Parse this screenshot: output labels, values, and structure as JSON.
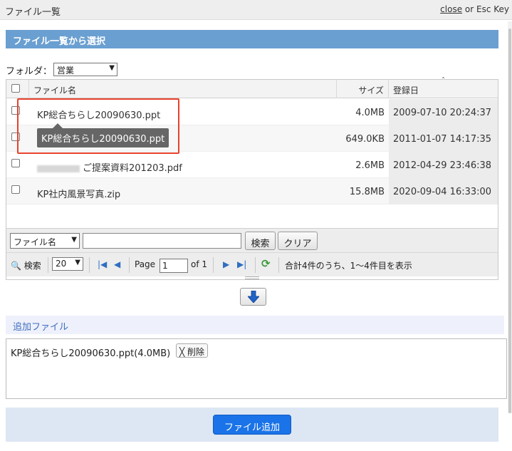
{
  "window": {
    "title": "ファイル一覧",
    "close_link": "close",
    "close_suffix": " or Esc Key"
  },
  "panel": {
    "header": "ファイル一覧から選択",
    "folder_label": "フォルダ：",
    "folder_value": "営業"
  },
  "grid": {
    "columns": {
      "name": "ファイル名",
      "size": "サイズ",
      "date": "登録日"
    },
    "rows": [
      {
        "name": "KP総合ちらし20090630.ppt",
        "size": "4.0MB",
        "date": "2009-07-10 20:24:37"
      },
      {
        "name": "",
        "size": "649.0KB",
        "date": "2011-01-07 14:17:35"
      },
      {
        "name": "ご提案資料201203.pdf",
        "size": "2.6MB",
        "date": "2012-04-29 23:46:38"
      },
      {
        "name": "KP社内風景写真.zip",
        "size": "15.8MB",
        "date": "2020-09-04 16:33:00"
      }
    ],
    "tooltip": "KP総合ちらし20090630.ppt"
  },
  "search": {
    "field_value": "ファイル名",
    "input_value": "",
    "search_label": "検索",
    "clear_label": "クリア"
  },
  "pager": {
    "search_toggle": "検索",
    "page_size": "20",
    "page_label": "Page",
    "page_value": "1",
    "of_label": "of 1",
    "summary": "合計4件のうち、1〜4件目を表示"
  },
  "added": {
    "header": "追加ファイル",
    "file": "KP総合ちらし20090630.ppt(4.0MB)",
    "delete_label": "╳ 削除"
  },
  "footer": {
    "add_label": "ファイル追加"
  },
  "colors": {
    "section_header": "#6a9fd1",
    "primary_button": "#1a73e8",
    "highlight": "#e8412c",
    "tooltip_bg": "#666666"
  }
}
